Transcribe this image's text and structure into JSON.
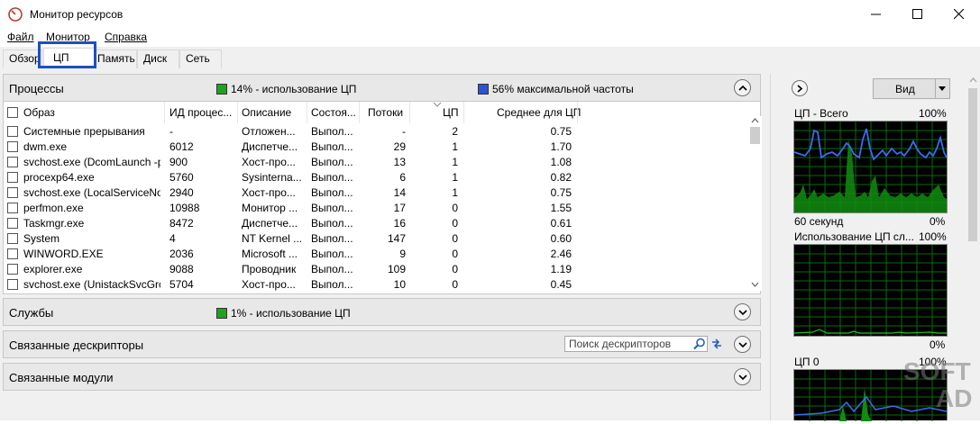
{
  "window": {
    "title": "Монитор ресурсов"
  },
  "menu": [
    "Файл",
    "Монитор",
    "Справка"
  ],
  "tabs": [
    "Обзор",
    "ЦП",
    "Память",
    "Диск",
    "Сеть"
  ],
  "processes_panel": {
    "title": "Процессы",
    "cpu_usage": "14% - использование ЦП",
    "max_freq": "56% максимальной частоты",
    "cpu_color": "#1fa31f",
    "freq_color": "#2855d8",
    "columns": [
      "Образ",
      "ИД процес...",
      "Описание",
      "Состоя...",
      "Потоки",
      "ЦП",
      "Среднее для ЦП"
    ],
    "rows": [
      [
        "Системные прерывания",
        "-",
        "Отложен...",
        "Выпол...",
        "-",
        "2",
        "0.75"
      ],
      [
        "dwm.exe",
        "6012",
        "Диспетче...",
        "Выпол...",
        "29",
        "1",
        "1.70"
      ],
      [
        "svchost.exe (DcomLaunch -p)",
        "900",
        "Хост-про...",
        "Выпол...",
        "13",
        "1",
        "1.08"
      ],
      [
        "procexp64.exe",
        "5760",
        "Sysinterna...",
        "Выпол...",
        "6",
        "1",
        "0.82"
      ],
      [
        "svchost.exe (LocalServiceNo...",
        "2940",
        "Хост-про...",
        "Выпол...",
        "14",
        "1",
        "0.75"
      ],
      [
        "perfmon.exe",
        "10988",
        "Монитор ...",
        "Выпол...",
        "17",
        "0",
        "1.55"
      ],
      [
        "Taskmgr.exe",
        "8472",
        "Диспетче...",
        "Выпол...",
        "16",
        "0",
        "0.61"
      ],
      [
        "System",
        "4",
        "NT Kernel ...",
        "Выпол...",
        "147",
        "0",
        "0.60"
      ],
      [
        "WINWORD.EXE",
        "2036",
        "Microsoft ...",
        "Выпол...",
        "9",
        "0",
        "2.46"
      ],
      [
        "explorer.exe",
        "9088",
        "Проводник",
        "Выпол...",
        "109",
        "0",
        "1.19"
      ],
      [
        "svchost.exe (UnistackSvcGro...",
        "5704",
        "Хост-про...",
        "Выпол...",
        "10",
        "0",
        "0.45"
      ]
    ]
  },
  "services_panel": {
    "title": "Службы",
    "cpu_usage": "1% - использование ЦП"
  },
  "handles_panel": {
    "title": "Связанные дескрипторы",
    "search_placeholder": "Поиск дескрипторов"
  },
  "modules_panel": {
    "title": "Связанные модули"
  },
  "right_pane": {
    "view_button": "Вид",
    "graphs": [
      {
        "title": "ЦП - Всего",
        "max": "100%",
        "footer_left": "60 секунд",
        "footer_right": "0%"
      },
      {
        "title": "Использование ЦП сл...",
        "max": "100%",
        "footer_right": "0%"
      },
      {
        "title": "ЦП 0",
        "max": "100%"
      }
    ]
  },
  "watermark": "SOFT AD",
  "icons": [
    "resource-monitor-icon",
    "minimize-icon",
    "maximize-icon",
    "close-icon",
    "collapse-up-icon",
    "expand-down-icon",
    "search-icon",
    "refresh-icon",
    "chevron-right-icon",
    "dropdown-arrow-icon",
    "sort-arrow-icon"
  ]
}
